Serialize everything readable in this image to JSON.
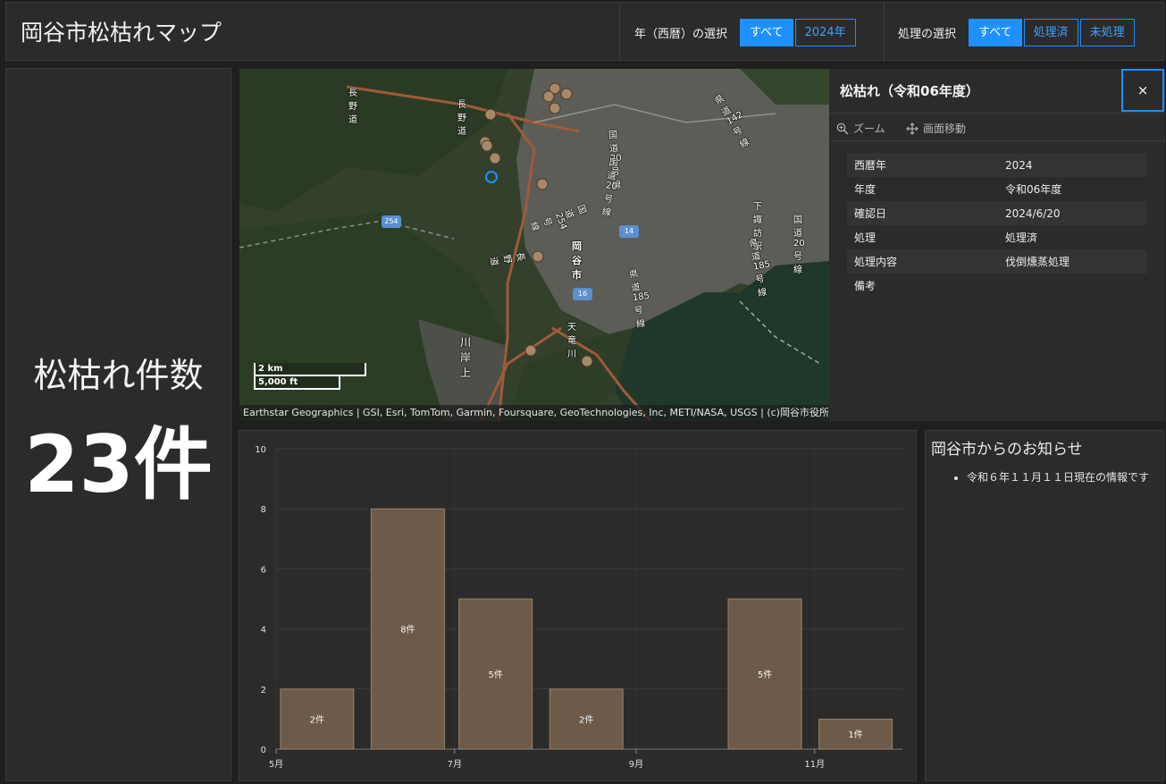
{
  "header": {
    "title": "岡谷市松枯れマップ",
    "year_filter": {
      "label": "年（西暦）の選択",
      "options": [
        "すべて",
        "2024年"
      ],
      "selected": "すべて"
    },
    "process_filter": {
      "label": "処理の選択",
      "options": [
        "すべて",
        "処理済",
        "未処理"
      ],
      "selected": "すべて"
    }
  },
  "count": {
    "label": "松枯れ件数",
    "value": "23件"
  },
  "map": {
    "attribution": "Earthstar Geographics | GSI, Esri, TomTom, Garmin, Foursquare, GeoTechnologies, Inc, METI/NASA, USGS | (c)岡谷市役所",
    "scale_metric": "2 km",
    "scale_imperial": "5,000 ft",
    "labels": [
      "長野道",
      "長野道",
      "国道20号線",
      "県道142号線",
      "国道20号線",
      "下諏訪駅",
      "岡谷市",
      "県道185号線",
      "県道185号線",
      "国道20号線",
      "天竜川",
      "川岸上",
      "長野道",
      "国道254号線"
    ],
    "road_shields": [
      "254",
      "14",
      "16"
    ]
  },
  "popup": {
    "title": "松枯れ（令和06年度）",
    "close_label": "×",
    "actions": [
      "ズーム",
      "画面移動"
    ],
    "attributes": [
      {
        "key": "西暦年",
        "value": "2024"
      },
      {
        "key": "年度",
        "value": "令和06年度"
      },
      {
        "key": "確認日",
        "value": "2024/6/20"
      },
      {
        "key": "処理",
        "value": "処理済"
      },
      {
        "key": "処理内容",
        "value": "伐倒燻蒸処理"
      },
      {
        "key": "備考",
        "value": ""
      }
    ]
  },
  "chart_data": {
    "type": "bar",
    "x": [
      "2024-05-15",
      "2024-06-15",
      "2024-07-15",
      "2024-08-15",
      "2024-10-15",
      "2024-11-15"
    ],
    "values": [
      2,
      8,
      5,
      2,
      5,
      1
    ],
    "data_labels": [
      "2件",
      "8件",
      "5件",
      "2件",
      "5件",
      "1件"
    ],
    "x_ticks": [
      "5月",
      "7月",
      "9月",
      "11月"
    ],
    "y_ticks": [
      0,
      2,
      4,
      6,
      8,
      10
    ],
    "ylim": [
      0,
      10
    ],
    "title": "",
    "xlabel": "",
    "ylabel": "",
    "grid": true,
    "bar_color": "#6e5a48",
    "bar_edge_color": "#9c8068"
  },
  "notice": {
    "title": "岡谷市からのお知らせ",
    "items": [
      "令和６年１１月１１日現在の情報です"
    ]
  },
  "colors": {
    "accent": "#1e90ff",
    "background": "#1f1f1f",
    "panel": "#2b2b2b",
    "marker": "#a88868"
  }
}
